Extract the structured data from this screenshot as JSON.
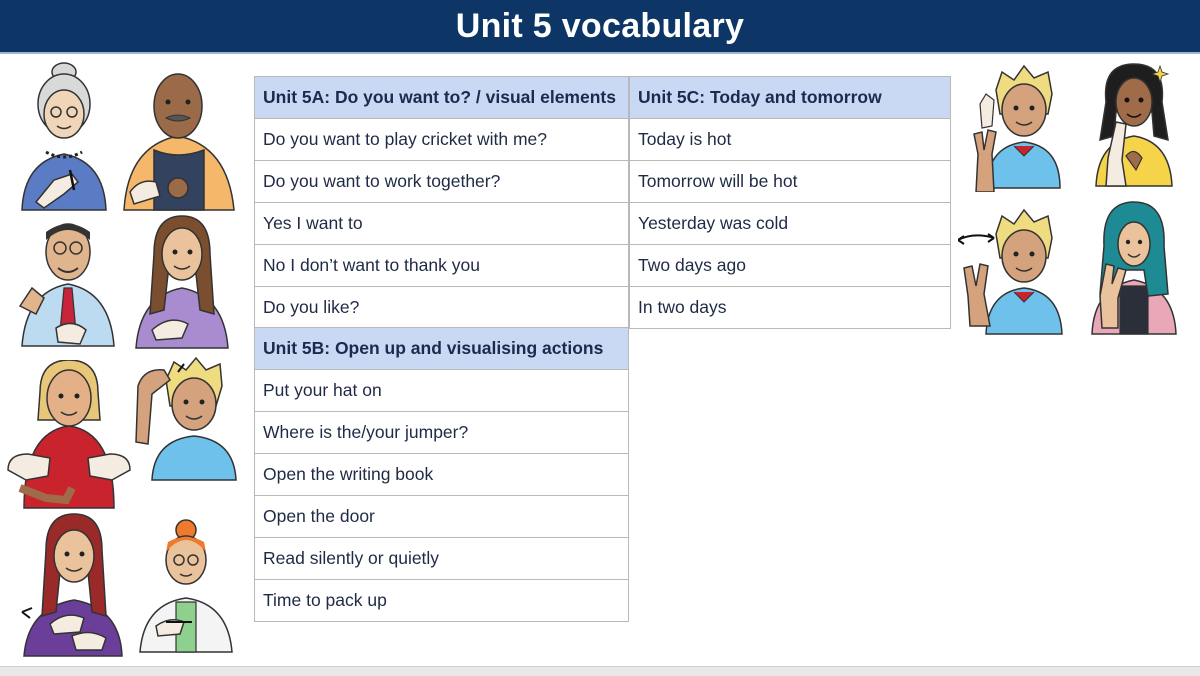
{
  "title": "Unit 5 vocabulary",
  "unit_5a": {
    "heading": "Unit 5A: Do you want to? / visual elements",
    "rows": [
      "Do you want to play cricket with me?",
      "Do you want to work together?",
      "Yes I want to",
      "No I don’t want to thank you",
      "Do you like?"
    ]
  },
  "unit_5b": {
    "heading": "Unit 5B: Open up and visualising actions",
    "rows": [
      "Put your hat on",
      "Where is the/your jumper?",
      "Open the writing book",
      "Open the door",
      "Read silently or quietly",
      "Time to pack up"
    ]
  },
  "unit_5c": {
    "heading": "Unit 5C: Today and tomorrow",
    "rows": [
      "Today is hot",
      "Tomorrow will be hot",
      "Yesterday was cold",
      "Two days ago",
      "In two days"
    ]
  },
  "colors": {
    "title_bar": "#0d3566",
    "header_fill": "#c9d9f3",
    "grid_line": "#b9b9b9"
  },
  "illustrations": [
    "signer-grandmother-icon",
    "signer-man-overalls-icon",
    "signer-man-glasses-tie-icon",
    "signer-woman-long-hair-icon",
    "signer-boy-red-jumper-icon",
    "signer-boy-hat-sign-icon",
    "signer-woman-red-hair-icon",
    "signer-woman-lab-coat-icon",
    "signer-boy-today-icon",
    "signer-girl-yellow-top-icon",
    "signer-boy-two-days-icon",
    "signer-woman-hijab-icon"
  ]
}
